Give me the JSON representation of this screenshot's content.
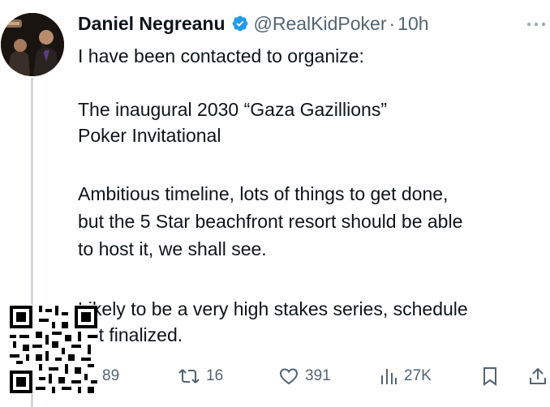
{
  "tweet": {
    "author_name": "Daniel Negreanu",
    "handle": "@RealKidPoker",
    "separator": "·",
    "time": "10h",
    "lines": [
      "I have been contacted to organize:",
      "The inaugural 2030 “Gaza Gazillions”",
      "Poker Invitational",
      "Ambitious timeline, lots of things to get done,",
      "but the 5 Star beachfront resort should be able",
      "to host it, we shall see.",
      "Likely to be a very high stakes series, schedule",
      "not finalized."
    ]
  },
  "actions": {
    "replies": "89",
    "reposts": "16",
    "likes": "391",
    "views": "27K"
  },
  "icons": {
    "verified": "verified-badge-icon",
    "more": "more-dots-icon",
    "reply": "reply-icon",
    "repost": "repost-icon",
    "like": "heart-icon",
    "views": "views-chart-icon",
    "bookmark": "bookmark-icon",
    "share": "share-icon"
  },
  "colors": {
    "text": "#0f1419",
    "muted": "#536471",
    "verified_blue": "#1d9bf0",
    "thread_line": "#cfd9de"
  }
}
